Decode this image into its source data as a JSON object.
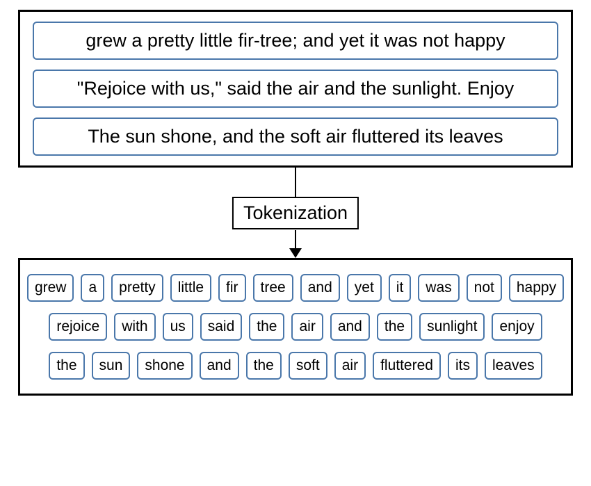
{
  "input": {
    "sentences": [
      "grew a pretty little fir-tree; and yet it was not happy",
      "\"Rejoice with us,\" said the air and the sunlight. Enjoy",
      "The sun shone, and the soft air fluttered its leaves"
    ]
  },
  "process": {
    "label": "Tokenization"
  },
  "output": {
    "rows": [
      [
        "grew",
        "a",
        "pretty",
        "little",
        "fir",
        "tree",
        "and",
        "yet",
        "it",
        "was",
        "not",
        "happy"
      ],
      [
        "rejoice",
        "with",
        "us",
        "said",
        "the",
        "air",
        "and",
        "the",
        "sunlight",
        "enjoy"
      ],
      [
        "the",
        "sun",
        "shone",
        "and",
        "the",
        "soft",
        "air",
        "fluttered",
        "its",
        "leaves"
      ]
    ]
  },
  "colors": {
    "tokenBorder": "#4a77aa",
    "boxBorder": "#000000"
  }
}
